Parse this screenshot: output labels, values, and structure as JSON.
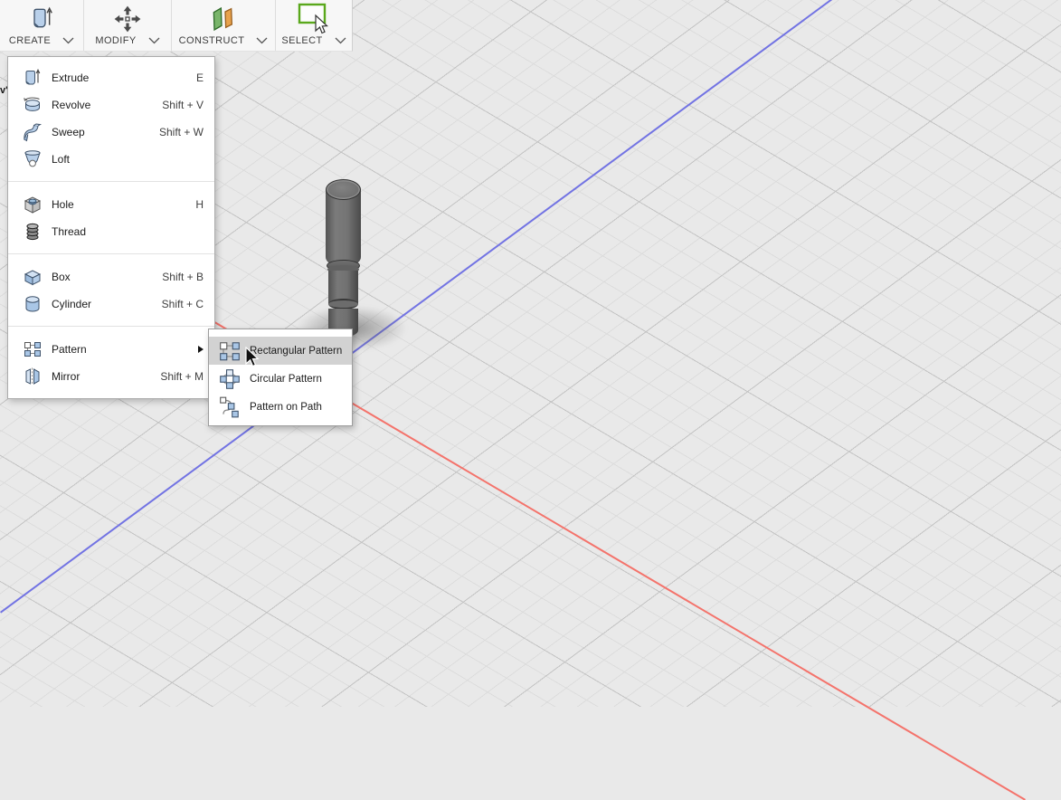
{
  "toolbar": {
    "groups": [
      {
        "label": "CREATE",
        "icon": "create-icon"
      },
      {
        "label": "MODIFY",
        "icon": "modify-icon"
      },
      {
        "label": "CONSTRUCT",
        "icon": "construct-icon"
      },
      {
        "label": "SELECT",
        "icon": "select-icon"
      }
    ]
  },
  "canvas": {
    "left_edge_fragment": "v'",
    "object": "stepped-cylinder-shaft",
    "background": "#e9e9e9",
    "grid_minor_color": "#dbdbdb",
    "grid_major_color": "#c3c3c3",
    "x_axis_color": "#f4736b",
    "y_axis_color": "#7273e3"
  },
  "create_menu": {
    "groups": [
      {
        "items": [
          {
            "label": "Extrude",
            "shortcut": "E",
            "icon": "extrude-icon"
          },
          {
            "label": "Revolve",
            "shortcut": "Shift + V",
            "icon": "revolve-icon"
          },
          {
            "label": "Sweep",
            "shortcut": "Shift + W",
            "icon": "sweep-icon"
          },
          {
            "label": "Loft",
            "shortcut": "",
            "icon": "loft-icon"
          }
        ]
      },
      {
        "items": [
          {
            "label": "Hole",
            "shortcut": "H",
            "icon": "hole-icon"
          },
          {
            "label": "Thread",
            "shortcut": "",
            "icon": "thread-icon"
          }
        ]
      },
      {
        "items": [
          {
            "label": "Box",
            "shortcut": "Shift + B",
            "icon": "box-icon"
          },
          {
            "label": "Cylinder",
            "shortcut": "Shift + C",
            "icon": "cylinder-icon"
          }
        ]
      },
      {
        "items": [
          {
            "label": "Pattern",
            "shortcut": "",
            "icon": "pattern-icon",
            "has_submenu": true
          },
          {
            "label": "Mirror",
            "shortcut": "Shift + M",
            "icon": "mirror-icon"
          }
        ]
      }
    ]
  },
  "pattern_submenu": {
    "highlight_color": "#d2d2d2",
    "items": [
      {
        "label": "Rectangular Pattern",
        "icon": "rectangular-pattern-icon",
        "highlighted": true
      },
      {
        "label": "Circular Pattern",
        "icon": "circular-pattern-icon",
        "highlighted": false
      },
      {
        "label": "Pattern on Path",
        "icon": "pattern-on-path-icon",
        "highlighted": false
      }
    ]
  }
}
